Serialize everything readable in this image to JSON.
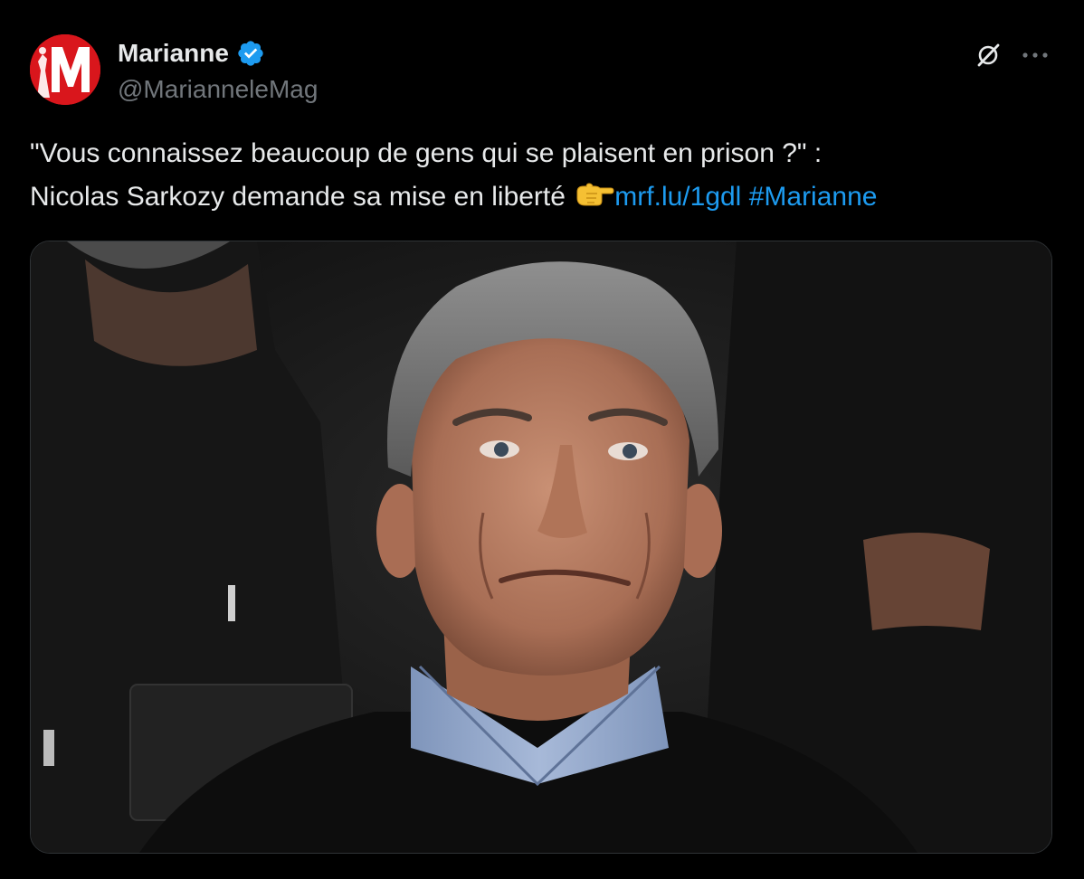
{
  "tweet": {
    "author": {
      "display_name": "Marianne",
      "handle": "@MarianneleMag",
      "verified": true,
      "avatar_letter": "M"
    },
    "text_line1": "\"Vous connaissez beaucoup de gens qui se plaisent en prison ?\" :",
    "text_line2_prefix": "Nicolas Sarkozy demande sa mise en liberté",
    "emoji": "backhand-index-pointing-right-emoji",
    "link": "mrf.lu/1gdl",
    "hashtag": "#Marianne",
    "media": {
      "icon": "photo-of-man-in-stadium-stands"
    }
  },
  "actions": {
    "grok_icon": "grok-icon",
    "more_icon": "more-icon"
  },
  "colors": {
    "background": "#000000",
    "text": "#e7e9ea",
    "secondary": "#71767b",
    "accent": "#1d9bf0",
    "brand_red": "#d9161c"
  }
}
